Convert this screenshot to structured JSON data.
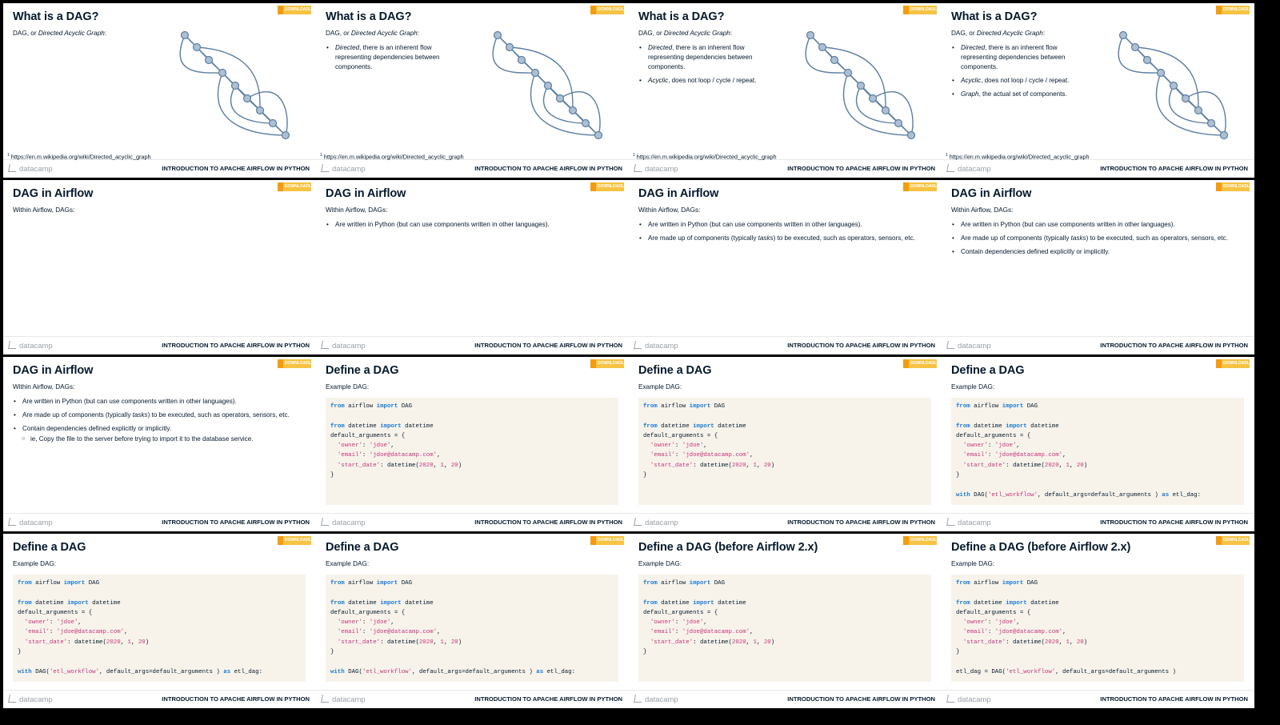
{
  "course": "INTRODUCTION TO APACHE AIRFLOW IN PYTHON",
  "brand": "datacamp",
  "watermark": "DOWNLOADLY.IR",
  "colors": {
    "text": "#05192d",
    "code_bg": "#f7f3eb",
    "keyword": "#1a7bd6",
    "string": "#c7357c",
    "graph": "#5b7fa3"
  },
  "dag_slides": {
    "title": "What is a DAG?",
    "subtitle_prefix": "DAG, or ",
    "subtitle_em": "Directed Acyclic Graph",
    "subtitle_suffix": ":",
    "bullet1_em": "Directed",
    "bullet1_rest": ", there is an inherent flow representing dependencies between components.",
    "bullet2_em": "Acyclic",
    "bullet2_rest": ", does not loop / cycle / repeat.",
    "bullet3_em": "Graph",
    "bullet3_rest": ", the actual set of components.",
    "footnote_num": "1",
    "footnote": " https://en.m.wikipedia.org/wiki/Directed_acyclic_graph"
  },
  "airflow_slides": {
    "title": "DAG in Airflow",
    "subtitle": "Within Airflow, DAGs:",
    "bullet1": "Are written in Python (but can use components written in other languages).",
    "bullet2_pre": "Are made up of components (typically ",
    "bullet2_em": "tasks",
    "bullet2_post": ") to be executed, such as operators, sensors, etc.",
    "bullet3": "Contain dependencies defined explicitly or implicitly.",
    "sub_bullet": "ie, Copy the file to the server before trying to import it to the database service."
  },
  "define_slides": {
    "title": "Define a DAG",
    "title_legacy": "Define a DAG (before Airflow 2.x)",
    "subtitle": "Example DAG:",
    "code": {
      "l1_kw1": "from",
      "l1_mid": " airflow ",
      "l1_kw2": "import",
      "l1_end": " DAG",
      "l3_kw1": "from",
      "l3_mid": " datetime ",
      "l3_kw2": "import",
      "l3_end": " datetime",
      "l4": "default_arguments = {",
      "l5_key": "  'owner'",
      "l5_sep": ": ",
      "l5_val": "'jdoe'",
      "l5_end": ",",
      "l6_key": "  'email'",
      "l6_sep": ": ",
      "l6_val": "'jdoe@datacamp.com'",
      "l6_end": ",",
      "l7_key": "  'start_date'",
      "l7_sep": ": datetime(",
      "l7_n1": "2020",
      "l7_c1": ", ",
      "l7_n2": "1",
      "l7_c2": ", ",
      "l7_n3": "20",
      "l7_end": ")",
      "l8": "}",
      "with_kw": "with",
      "with_mid": " DAG(",
      "with_str": "'etl_workflow'",
      "with_args": ", default_args=default_arguments ) ",
      "with_as": "as",
      "with_end": " etl_dag:",
      "assign_pre": "etl_dag = DAG(",
      "assign_str": "'etl_workflow'",
      "assign_end": ", default_args=default_arguments )"
    }
  }
}
